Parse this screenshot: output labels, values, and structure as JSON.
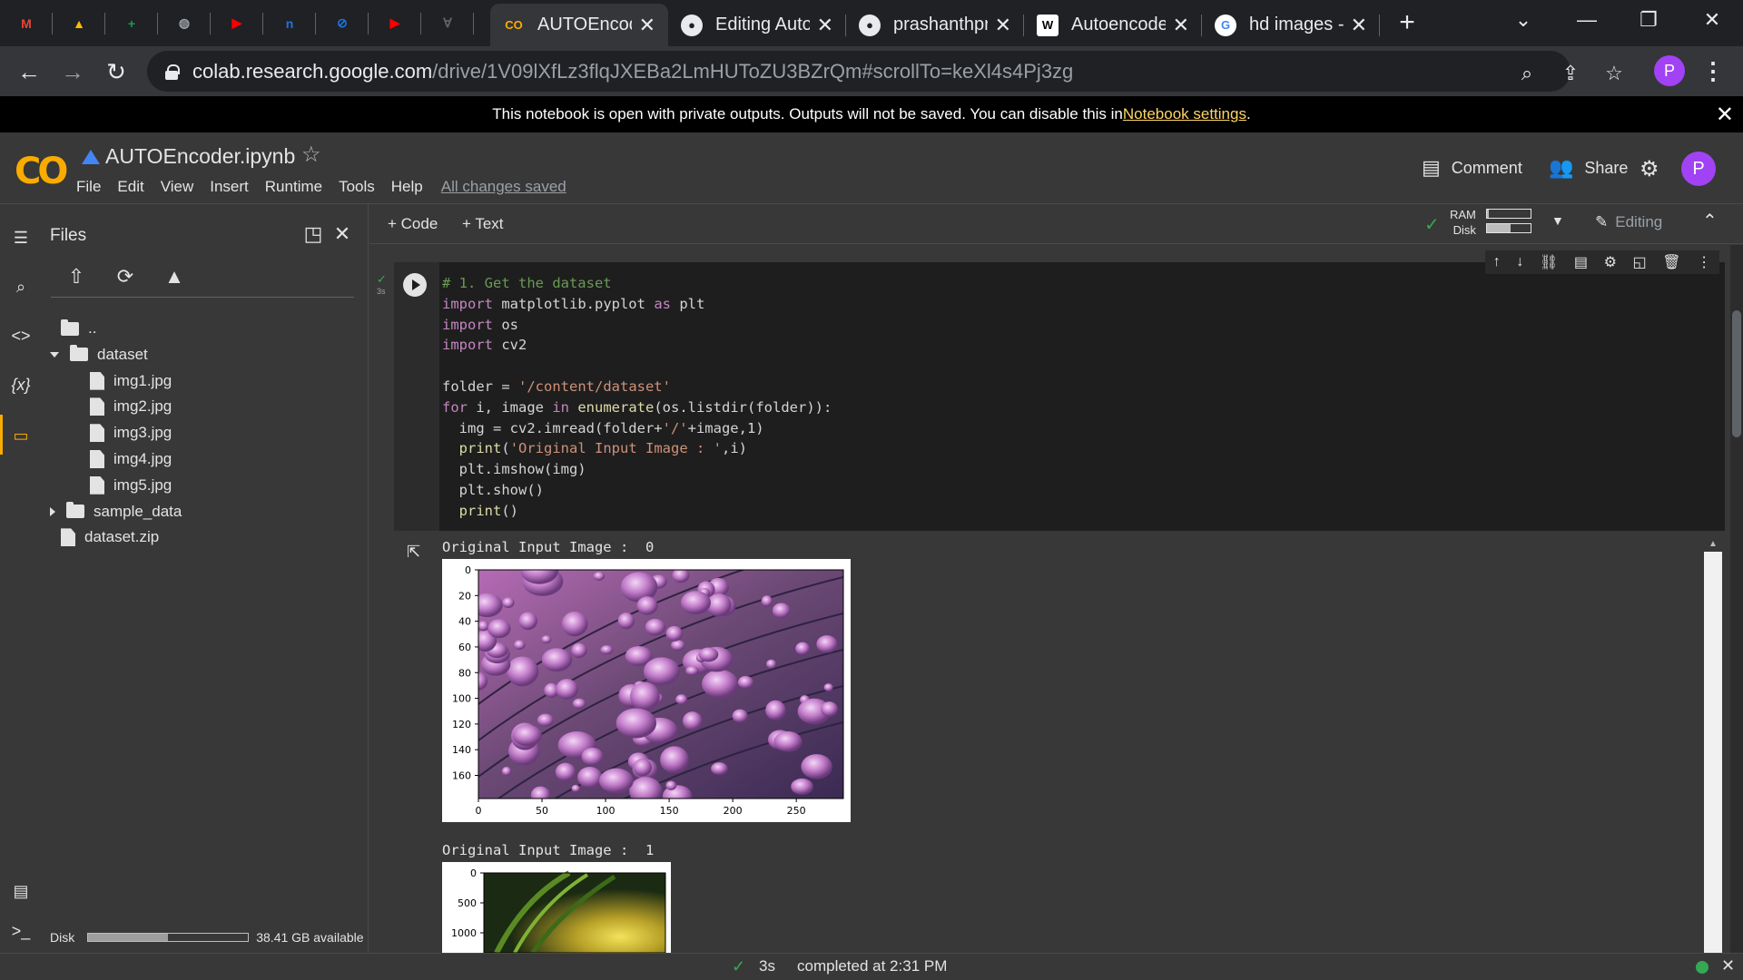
{
  "browser": {
    "pinned_tabs": [
      {
        "icon": "gmail-icon",
        "color": "#ea4335",
        "glyph": "M"
      },
      {
        "icon": "drive-icon",
        "color": "#fbbc04",
        "glyph": "▲"
      },
      {
        "icon": "sheets-plus-icon",
        "color": "#0f9d58",
        "glyph": "+"
      },
      {
        "icon": "globe-icon",
        "color": "#9aa0a6",
        "glyph": "◍"
      },
      {
        "icon": "youtube-icon",
        "color": "#ff0000",
        "glyph": "▶"
      },
      {
        "icon": "outline-icon",
        "color": "#1a73e8",
        "glyph": "n"
      },
      {
        "icon": "compass-icon",
        "color": "#1a73e8",
        "glyph": "⊘"
      },
      {
        "icon": "youtube-icon",
        "color": "#ff0000",
        "glyph": "▶"
      },
      {
        "icon": "translate-icon",
        "color": "#5f6368",
        "glyph": "Ɐ"
      }
    ],
    "tabs": [
      {
        "title": "AUTOEncoder",
        "icon": "colab-icon",
        "active": true
      },
      {
        "title": "Editing AutoEnc",
        "icon": "github-icon",
        "active": false
      },
      {
        "title": "prashanthprasad",
        "icon": "github-icon",
        "active": false
      },
      {
        "title": "Autoencoder",
        "icon": "wikipedia-icon",
        "active": false
      },
      {
        "title": "hd images - Go",
        "icon": "google-icon",
        "active": false
      }
    ],
    "url_domain": "colab.research.google.com",
    "url_path": "/drive/1V09lXfLz3flqJXEBa2LmHUToZU3BZrQm#scrollTo=keXl4s4Pj3zg",
    "profile_initial": "P"
  },
  "notice": {
    "text": "This notebook is open with private outputs. Outputs will not be saved. You can disable this in ",
    "link": "Notebook settings",
    "end": "."
  },
  "colab": {
    "logo": "CO",
    "notebook_title": "AUTOEncoder.ipynb",
    "menus": [
      "File",
      "Edit",
      "View",
      "Insert",
      "Runtime",
      "Tools",
      "Help"
    ],
    "save_status": "All changes saved",
    "comment_label": "Comment",
    "share_label": "Share",
    "avatar_initial": "P"
  },
  "files_panel": {
    "title": "Files",
    "tree": [
      {
        "name": "..",
        "type": "up",
        "depth": 0
      },
      {
        "name": "dataset",
        "type": "folder",
        "depth": 0,
        "expanded": true
      },
      {
        "name": "img1.jpg",
        "type": "file",
        "depth": 1
      },
      {
        "name": "img2.jpg",
        "type": "file",
        "depth": 1
      },
      {
        "name": "img3.jpg",
        "type": "file",
        "depth": 1
      },
      {
        "name": "img4.jpg",
        "type": "file",
        "depth": 1
      },
      {
        "name": "img5.jpg",
        "type": "file",
        "depth": 1
      },
      {
        "name": "sample_data",
        "type": "folder",
        "depth": 0,
        "expanded": false
      },
      {
        "name": "dataset.zip",
        "type": "file",
        "depth": 0
      }
    ],
    "disk_label": "Disk",
    "disk_available": "38.41 GB available",
    "disk_used_fraction": 0.5
  },
  "toolbar": {
    "add_code": "+ Code",
    "add_text": "+ Text",
    "ram_label": "RAM",
    "disk_label": "Disk",
    "ram_fraction": 0.05,
    "disk_fraction": 0.55,
    "mode_label": "Editing"
  },
  "cell": {
    "exec_time": "3s",
    "code_lines": [
      "# 1. Get the dataset",
      "import matplotlib.pyplot as plt",
      "import os",
      "import cv2",
      "",
      "folder = '/content/dataset'",
      "for i, image in enumerate(os.listdir(folder)):",
      "  img = cv2.imread(folder+'/'+image,1)",
      "  print('Original Input Image : ',i)",
      "  plt.imshow(img)",
      "  plt.show()",
      "  print()"
    ]
  },
  "outputs": [
    {
      "label": "Original Input Image :  0",
      "xticks": [
        "0",
        "50",
        "100",
        "150",
        "200",
        "250"
      ],
      "yticks": [
        "0",
        "20",
        "40",
        "60",
        "80",
        "100",
        "120",
        "140",
        "160"
      ]
    },
    {
      "label": "Original Input Image :  1",
      "yticks": [
        "0",
        "500",
        "1000"
      ]
    }
  ],
  "status": {
    "time": "3s",
    "text": "completed at 2:31 PM"
  }
}
